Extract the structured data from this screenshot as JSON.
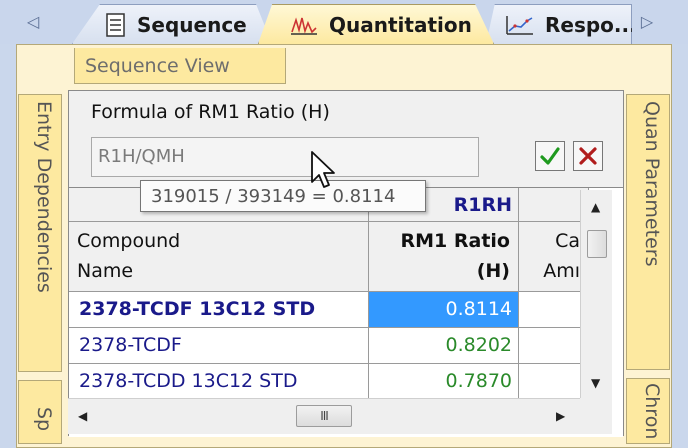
{
  "tabs": {
    "left_arrow": "◁",
    "right_arrow": "▷",
    "items": [
      {
        "label": "Sequence",
        "icon": "document-list-icon"
      },
      {
        "label": "Quantitation",
        "icon": "chromatogram-icon"
      },
      {
        "label": "Respo...",
        "icon": "response-chart-icon"
      }
    ]
  },
  "sequence_view_label": "Sequence View",
  "side_tabs": {
    "left": [
      "Entry Dependencies",
      "Sp"
    ],
    "right": [
      "Quan Parameters",
      "Chron"
    ]
  },
  "formula": {
    "label": "Formula of RM1 Ratio (H)",
    "value": "R1H/QMH",
    "ok": "✔",
    "cancel": "✖"
  },
  "tooltip": "319015 / 393149  = 0.8114",
  "grid": {
    "group_header": "R1RH",
    "columns": {
      "compound_line1": "Compound",
      "compound_line2": "Name",
      "ratio_line1": "RM1 Ratio",
      "ratio_line2": "(H)",
      "amount_line1": "Ca",
      "amount_line2": "Amı"
    },
    "rows": [
      {
        "name": "2378-TCDF 13C12 STD",
        "ratio": "0.8114",
        "selected": true
      },
      {
        "name": "2378-TCDF",
        "ratio": "0.8202",
        "selected": false
      },
      {
        "name": "2378-TCDD 13C12 STD",
        "ratio": "0.7870",
        "selected": false
      }
    ]
  },
  "scrollbar": {
    "up": "▲",
    "down": "▼",
    "left": "◀",
    "right": "▶",
    "grip": "III"
  },
  "colors": {
    "selected_bg": "#3399ff",
    "ratio_text": "#2a8a2a",
    "name_text": "#1a1a8a",
    "active_tab": "#fde9a0"
  }
}
